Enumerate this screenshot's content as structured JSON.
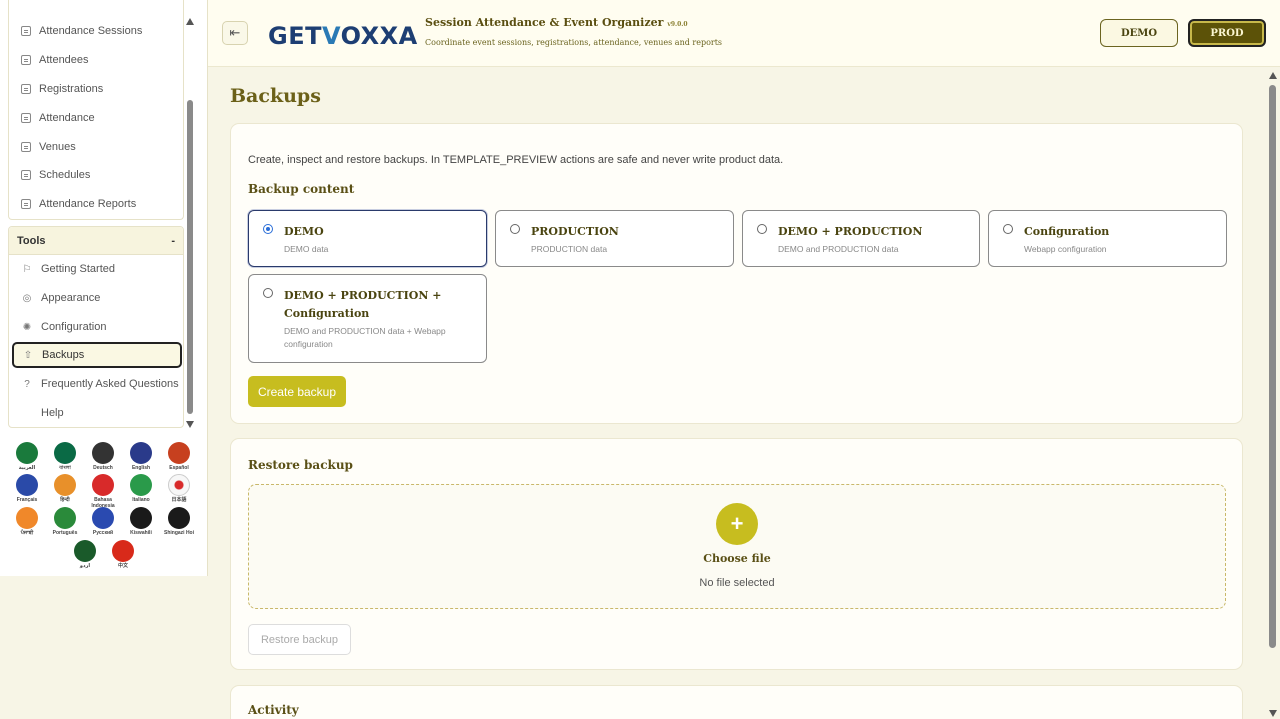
{
  "sidebar": {
    "top_items": [
      {
        "label": "Attendance Sessions",
        "icon": "doc-icon"
      },
      {
        "label": "Attendees",
        "icon": "doc-icon"
      },
      {
        "label": "Registrations",
        "icon": "doc-icon"
      },
      {
        "label": "Attendance",
        "icon": "doc-icon"
      },
      {
        "label": "Venues",
        "icon": "doc-icon"
      },
      {
        "label": "Schedules",
        "icon": "doc-icon"
      },
      {
        "label": "Attendance Reports",
        "icon": "doc-icon"
      }
    ],
    "tools": {
      "title": "Tools",
      "collapse_glyph": "-",
      "items": [
        {
          "label": "Getting Started",
          "icon": "rocket-icon"
        },
        {
          "label": "Appearance",
          "icon": "palette-icon"
        },
        {
          "label": "Configuration",
          "icon": "gear-icon"
        },
        {
          "label": "Backups",
          "icon": "upload-icon",
          "active": true
        },
        {
          "label": "Frequently Asked Questions",
          "icon": "question-icon"
        },
        {
          "label": "Help",
          "icon": ""
        }
      ]
    },
    "languages": [
      {
        "label": "العربية",
        "color": "#1a7a3c"
      },
      {
        "label": "বাংলা",
        "color": "#0a6a45"
      },
      {
        "label": "Deutsch",
        "color": "#333333"
      },
      {
        "label": "English",
        "color": "#2a3a8a"
      },
      {
        "label": "Español",
        "color": "#c7401f"
      },
      {
        "label": "Français",
        "color": "#2a4aa8"
      },
      {
        "label": "हिन्दी",
        "color": "#e8902a"
      },
      {
        "label": "Bahasa Indonesia",
        "color": "#d82a2a"
      },
      {
        "label": "Italiano",
        "color": "#2a9a4a"
      },
      {
        "label": "日本語",
        "color": "#f2f2f2"
      },
      {
        "label": "ਪੰਜਾਬੀ",
        "color": "#f0882a"
      },
      {
        "label": "Português",
        "color": "#2a8a3a"
      },
      {
        "label": "Русский",
        "color": "#2a4ab0"
      },
      {
        "label": "Kiswahili",
        "color": "#1a1a1a"
      },
      {
        "label": "Shingazi Hoi",
        "color": "#1a1a1a"
      },
      {
        "label": "اردو",
        "color": "#1a5a2a"
      },
      {
        "label": "中文",
        "color": "#d82a1a"
      }
    ]
  },
  "header": {
    "logo_pre": "GET",
    "logo_v": "V",
    "logo_post": "OXXA",
    "app_title": "Session Attendance & Event Organizer",
    "version": "v9.0.0",
    "subtitle": "Coordinate event sessions, registrations, attendance, venues and reports",
    "demo_label": "DEMO",
    "prod_label": "PROD",
    "toggle_glyph": "⇤"
  },
  "main": {
    "page_title": "Backups",
    "intro": "Create, inspect and restore backups. In TEMPLATE_PREVIEW actions are safe and never write product data.",
    "backup_content_title": "Backup content",
    "options": [
      {
        "title": "DEMO",
        "desc": "DEMO data",
        "selected": true
      },
      {
        "title": "PRODUCTION",
        "desc": "PRODUCTION data"
      },
      {
        "title": "DEMO + PRODUCTION",
        "desc": "DEMO and PRODUCTION data"
      },
      {
        "title": "Configuration",
        "desc": "Webapp configuration"
      },
      {
        "title": "DEMO + PRODUCTION + Configuration",
        "desc": "DEMO and PRODUCTION data + Webapp configuration"
      }
    ],
    "create_backup_label": "Create backup",
    "restore_title": "Restore backup",
    "plus_glyph": "+",
    "choose_file": "Choose file",
    "no_file": "No file selected",
    "restore_button": "Restore backup",
    "activity_title": "Activity"
  },
  "colors": {
    "accent": "#c7bd1f",
    "title": "#6b6018",
    "prod_bg": "#5c5208"
  }
}
